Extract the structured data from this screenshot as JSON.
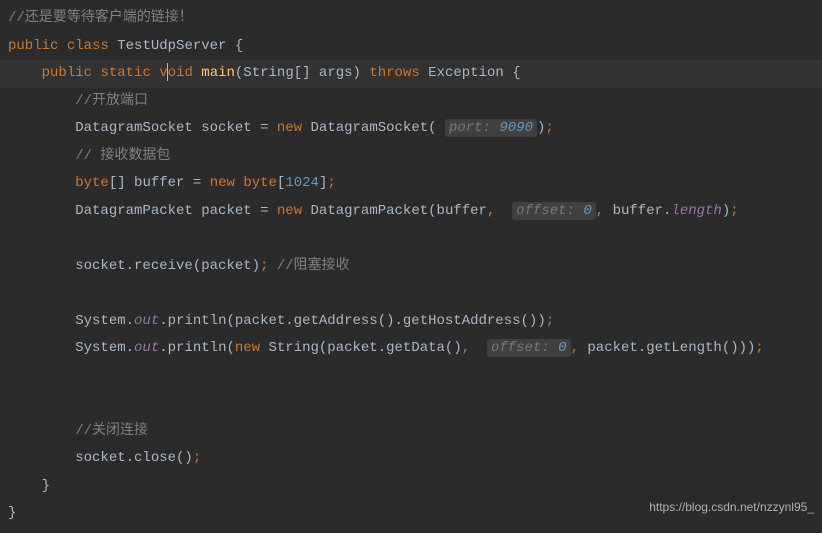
{
  "code": {
    "line1_comment": "//还是要等待客户端的链接！",
    "line2": {
      "kw_public": "public",
      "kw_class": "class",
      "class_name": "TestUdpServer",
      "brace": "{"
    },
    "line3": {
      "kw_public": "public",
      "kw_static": "static",
      "kw_void_v": "v",
      "kw_void_oid": "oid",
      "method": "main",
      "params": "(String[] args)",
      "kw_throws": "throws",
      "exception": "Exception",
      "brace": "{"
    },
    "line4_comment": "//开放端口",
    "line5": {
      "type": "DatagramSocket",
      "var": "socket",
      "eq": "=",
      "kw_new": "new",
      "ctor": "DatagramSocket",
      "paren_open": "(",
      "hint": "port:",
      "hint_val": "9090",
      "paren_close": ")",
      "semi": ";"
    },
    "line6_comment": "// 接收数据包",
    "line7": {
      "kw_byte": "byte",
      "brackets": "[]",
      "var": "buffer",
      "eq": "=",
      "kw_new": "new",
      "kw_byte2": "byte",
      "bracket_open": "[",
      "size": "1024",
      "bracket_close": "]",
      "semi": ";"
    },
    "line8": {
      "type": "DatagramPacket",
      "var": "packet",
      "eq": "=",
      "kw_new": "new",
      "ctor": "DatagramPacket",
      "paren_open": "(buffer",
      "comma1": ",",
      "hint": "offset:",
      "hint_val": "0",
      "comma2": ",",
      "buffer_dot": " buffer.",
      "length": "length",
      "paren_close": ")",
      "semi": ";"
    },
    "line10": {
      "stmt": "socket.receive(packet)",
      "semi": ";",
      "comment": "//阻塞接收"
    },
    "line12": {
      "sys": "System.",
      "out": "out",
      "dot": ".",
      "println": "println(packet.getAddress().getHostAddress())",
      "semi": ";"
    },
    "line13": {
      "sys": "System.",
      "out": "out",
      "dot": ".",
      "println_open": "println(",
      "kw_new": "new",
      "str_ctor": " String(packet.getData()",
      "comma1": ",",
      "hint": "offset:",
      "hint_val": "0",
      "comma2": ",",
      "rest": "packet.getLength()))",
      "semi": ";"
    },
    "line16_comment": "//关闭连接",
    "line17": {
      "stmt": "socket.close()",
      "semi": ";"
    },
    "line18_brace": "}",
    "line19_brace": "}"
  },
  "watermark": "https://blog.csdn.net/nzzynl95_"
}
